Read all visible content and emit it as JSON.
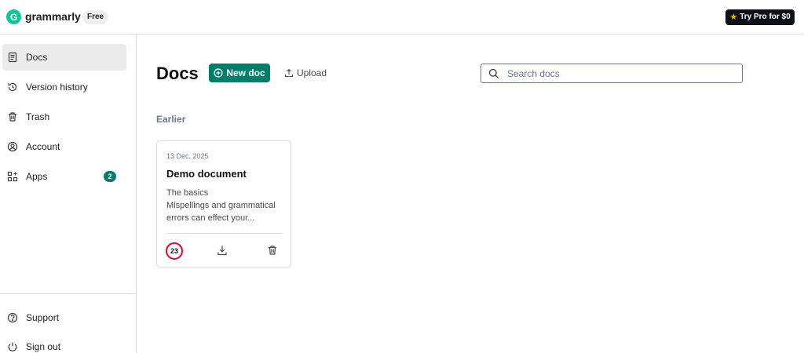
{
  "header": {
    "logo_text": "grammarly",
    "logo_letter": "G",
    "plan_badge": "Free",
    "pro_button": "Try Pro for $0"
  },
  "sidebar": {
    "items": [
      {
        "label": "Docs",
        "icon": "document-icon",
        "active": true
      },
      {
        "label": "Version history",
        "icon": "history-icon"
      },
      {
        "label": "Trash",
        "icon": "trash-icon"
      },
      {
        "label": "Account",
        "icon": "account-icon"
      },
      {
        "label": "Apps",
        "icon": "apps-icon",
        "badge": "2"
      }
    ],
    "bottom_items": [
      {
        "label": "Support",
        "icon": "help-icon"
      },
      {
        "label": "Sign out",
        "icon": "power-icon"
      }
    ]
  },
  "main": {
    "title": "Docs",
    "new_doc_label": "New doc",
    "upload_label": "Upload",
    "search_placeholder": "Search docs",
    "section_label": "Earlier",
    "documents": [
      {
        "date": "13 Dec, 2025",
        "title": "Demo document",
        "excerpt_lines": [
          "The basics",
          "Mispellings and grammatical",
          "errors can effect your..."
        ],
        "score": "23"
      }
    ]
  },
  "colors": {
    "brand": "#15c39a",
    "accent": "#007d6a",
    "score_ring": "#e1002d",
    "pro_button_bg": "#0e101a"
  }
}
